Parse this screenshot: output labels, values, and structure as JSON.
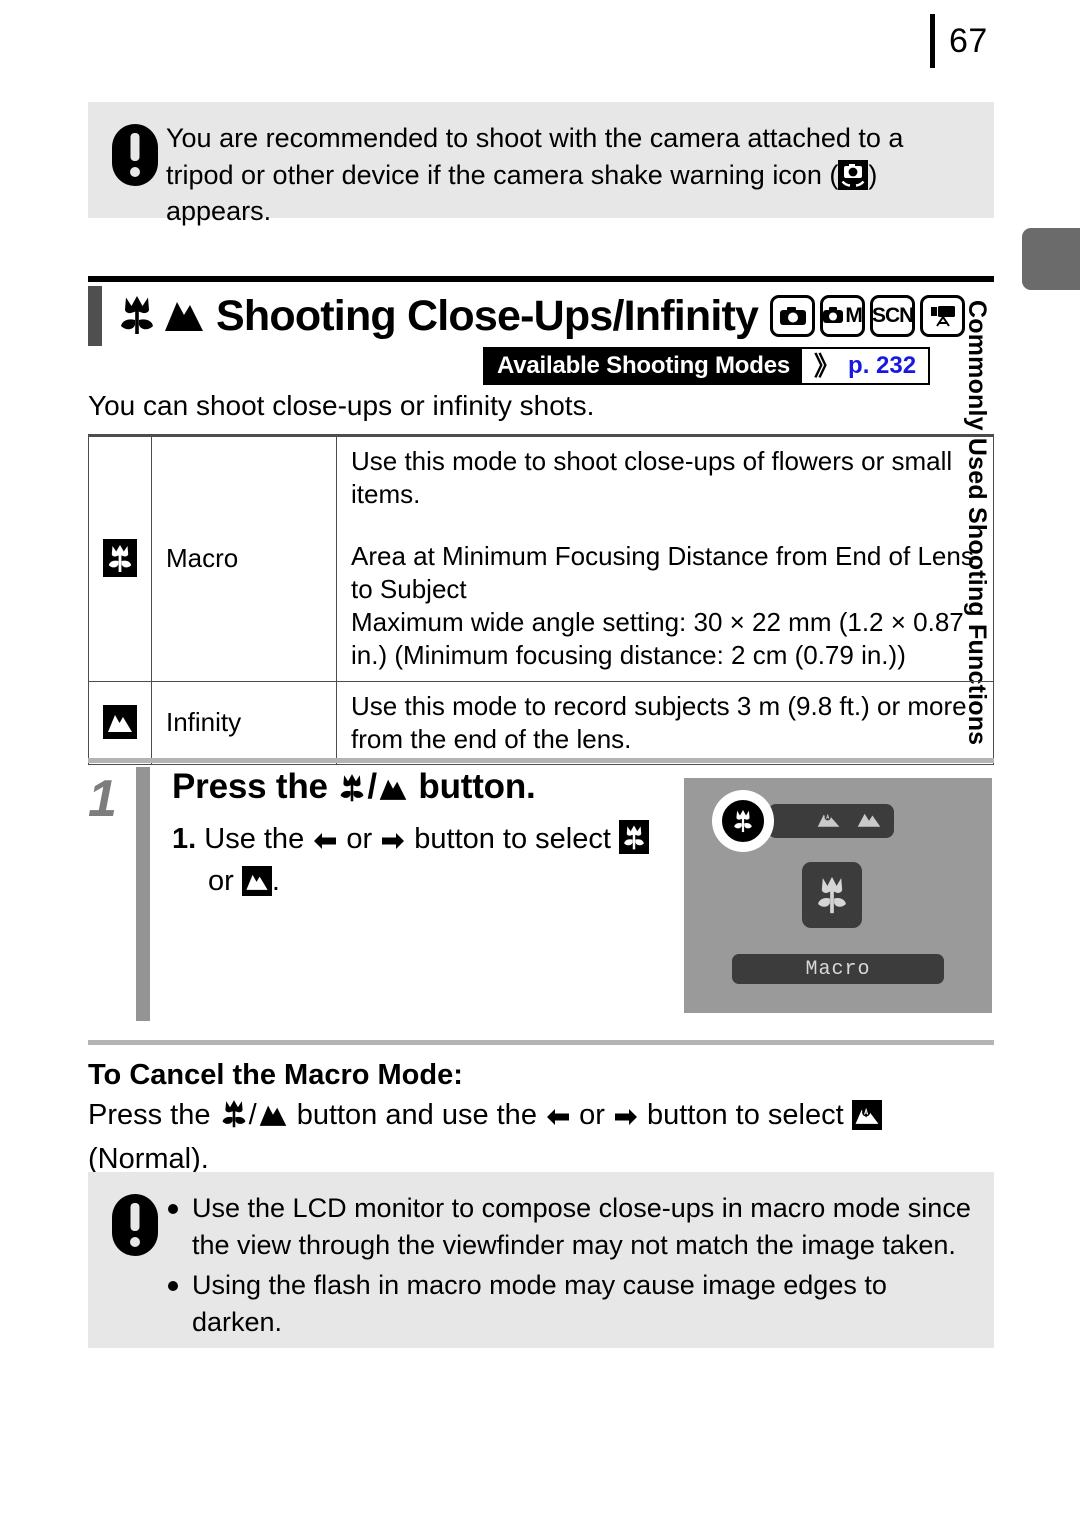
{
  "page": {
    "number": "67",
    "side_tab_label": "Commonly Used Shooting Functions"
  },
  "note_top": {
    "icon": "exclamation-icon",
    "text_part1": "You are recommended to shoot with the camera attached to a tripod or other device if the camera shake warning icon (",
    "inline_icon": "camera-shake-warning-icon",
    "text_part2": ") appears."
  },
  "heading": {
    "icon_macro": "macro-tulip-icon",
    "icon_infinity": "infinity-mountain-icon",
    "title": "Shooting Close-Ups/Infinity",
    "mode_chips": [
      {
        "name": "auto-camera-mode-icon",
        "label": ""
      },
      {
        "name": "manual-camera-mode-icon",
        "label": "M"
      },
      {
        "name": "scene-mode-icon",
        "label": "SCN"
      },
      {
        "name": "movie-mode-icon",
        "label": ""
      }
    ]
  },
  "available_modes": {
    "label": "Available Shooting Modes",
    "chevron": "》",
    "page_ref": "p. 232",
    "page_ref_color": "#1818e0"
  },
  "intro": "You can shoot close-ups or infinity shots.",
  "table": {
    "rows": [
      {
        "icon": "macro-tulip-icon",
        "name": "Macro",
        "desc_lines": [
          "Use this mode to shoot close-ups of flowers or small items.",
          "Area at Minimum Focusing Distance from End of Lens to Subject",
          "Maximum wide angle setting: 30 × 22 mm (1.2 × 0.87 in.) (Minimum focusing distance: 2 cm (0.79 in.))"
        ]
      },
      {
        "icon": "infinity-mountain-icon",
        "name": "Infinity",
        "desc_lines": [
          "Use this mode to record subjects 3 m (9.8 ft.) or more from the end of the lens."
        ]
      }
    ]
  },
  "step": {
    "number": "1",
    "title_pre": "Press the",
    "title_icon_macro": "macro-tulip-icon",
    "title_sep": "/",
    "title_icon_infinity": "infinity-mountain-icon",
    "title_post": "button.",
    "sub_index": "1.",
    "sub_pre": "Use the",
    "arrow_left": "←",
    "sub_or": "or",
    "arrow_right": "→",
    "sub_mid": "button to select",
    "sub_icon_macro": "macro-tulip-icon",
    "sub_cont_or": "or",
    "sub_icon_infinity": "infinity-mountain-icon",
    "sub_end": "."
  },
  "lcd": {
    "selected_icon": "macro-tulip-icon",
    "option_normal_icon": "normal-mode-icon",
    "option_infinity_icon": "infinity-mountain-icon",
    "big_icon": "macro-tulip-icon",
    "mode_label": "Macro",
    "background_color": "#9a9a9a",
    "bar_color": "#3c3c3c"
  },
  "cancel": {
    "title": "To Cancel the Macro Mode:",
    "pre": "Press the",
    "icon_macro": "macro-tulip-icon",
    "sep": "/",
    "icon_infinity": "infinity-mountain-icon",
    "mid": "button and use the",
    "arrow_left": "←",
    "or": "or",
    "arrow_right": "→",
    "mid2": "button to select",
    "icon_normal": "normal-mode-icon",
    "end": "(Normal)."
  },
  "note_bottom": {
    "icon": "exclamation-icon",
    "bullets": [
      "Use the LCD monitor to compose close-ups in macro mode since the view through the viewfinder may not match the image taken.",
      "Using the flash in macro mode may cause image edges to darken."
    ]
  }
}
